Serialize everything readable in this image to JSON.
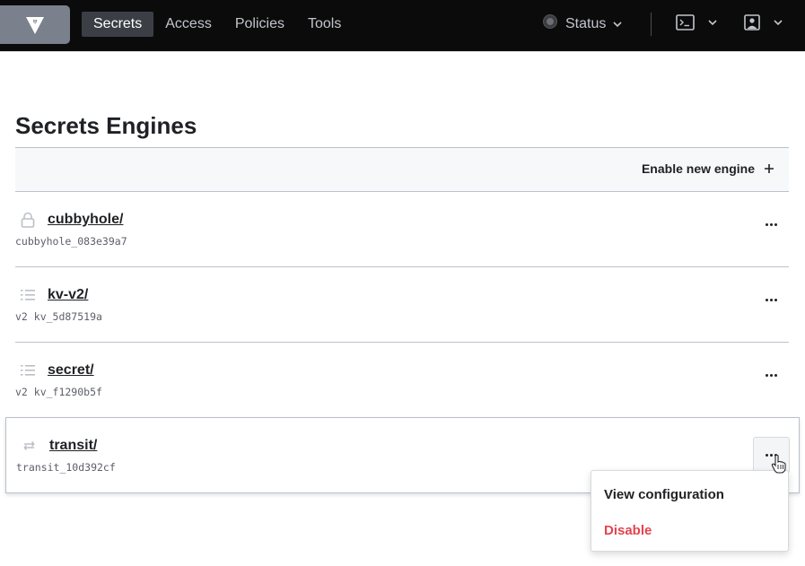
{
  "nav": {
    "logo": "vault-logo",
    "items": [
      {
        "label": "Secrets",
        "active": true
      },
      {
        "label": "Access",
        "active": false
      },
      {
        "label": "Policies",
        "active": false
      },
      {
        "label": "Tools",
        "active": false
      }
    ],
    "status_label": "Status",
    "console_icon": "terminal-icon",
    "user_icon": "user-icon"
  },
  "page": {
    "title": "Secrets Engines",
    "enable_label": "Enable new engine",
    "enable_icon": "+"
  },
  "engines": [
    {
      "name": "cubbyhole/",
      "accessor": "cubbyhole_083e39a7",
      "icon": "lock-icon"
    },
    {
      "name": "kv-v2/",
      "accessor": "v2 kv_5d87519a",
      "icon": "list-icon"
    },
    {
      "name": "secret/",
      "accessor": "v2 kv_f1290b5f",
      "icon": "list-icon"
    },
    {
      "name": "transit/",
      "accessor": "transit_10d392cf",
      "icon": "transit-arrows-icon"
    }
  ],
  "dropdown": {
    "view_label": "View configuration",
    "disable_label": "Disable",
    "disable_color": "#e5444f"
  },
  "colors": {
    "topbar_bg": "#0b0b0c",
    "active_nav_bg": "#3b3f45",
    "border": "#bac1cc"
  }
}
